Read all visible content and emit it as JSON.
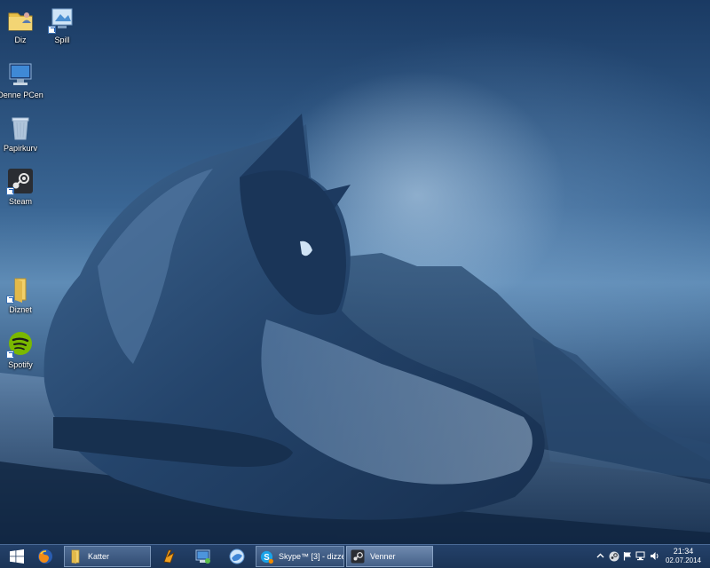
{
  "desktop": {
    "icons": [
      {
        "label": "Diz",
        "icon": "folder-user-icon"
      },
      {
        "label": "Spill",
        "icon": "games-shortcut-icon"
      },
      {
        "label": "Denne PCen",
        "icon": "computer-icon"
      },
      {
        "label": "Papirkurv",
        "icon": "recycle-bin-icon"
      },
      {
        "label": "Steam",
        "icon": "steam-icon"
      },
      {
        "label": "Diznet",
        "icon": "folder-icon"
      },
      {
        "label": "Spotify",
        "icon": "spotify-icon"
      }
    ],
    "wallpaper": "cat-on-rock-blue-tint"
  },
  "taskbar": {
    "start_icon": "windows-logo-icon",
    "pinned": [
      {
        "icon": "firefox-icon"
      }
    ],
    "windows": [
      {
        "label": "Katter",
        "icon": "folder-icon"
      },
      {
        "label": "Skype™ [3] - dizze...",
        "icon": "skype-icon"
      },
      {
        "label": "Venner",
        "icon": "steam-icon"
      }
    ],
    "extra_pinned": [
      {
        "icon": "winamp-icon"
      },
      {
        "icon": "remote-desktop-icon"
      },
      {
        "icon": "browser-globe-icon"
      }
    ],
    "tray": {
      "icons": [
        "chevron-up-icon",
        "steam-tray-icon",
        "flag-icon",
        "network-icon",
        "volume-icon"
      ],
      "time": "21:34",
      "date": "02.07.2014"
    }
  },
  "colors": {
    "taskbar": "#1f3a60",
    "window_button": "#6f8fb8",
    "spotify_green": "#7ab800",
    "folder_yellow": "#e8c04a"
  }
}
